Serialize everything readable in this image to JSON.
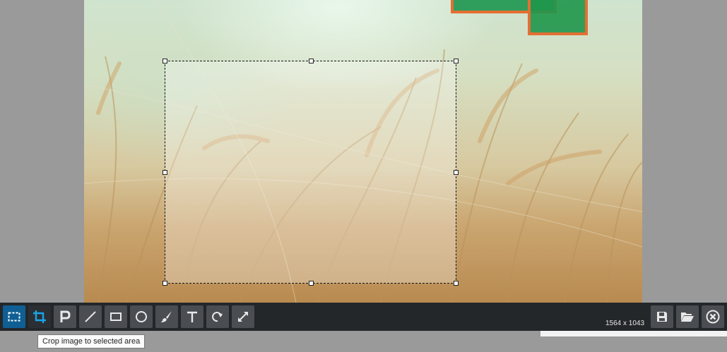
{
  "image": {
    "dimensions_text": "1564 x 1043"
  },
  "toolbar": {
    "tools": [
      {
        "name": "select-tool",
        "icon": "marquee-select-icon",
        "active": true
      },
      {
        "name": "crop-tool",
        "icon": "crop-icon",
        "active": false
      },
      {
        "name": "pixelate-tool",
        "icon": "pixelate-icon",
        "active": false
      },
      {
        "name": "line-tool",
        "icon": "line-icon",
        "active": false
      },
      {
        "name": "rectangle-tool",
        "icon": "rectangle-icon",
        "active": false
      },
      {
        "name": "ellipse-tool",
        "icon": "circle-icon",
        "active": false
      },
      {
        "name": "brush-tool",
        "icon": "brush-icon",
        "active": false
      },
      {
        "name": "text-tool",
        "icon": "text-icon",
        "active": false
      },
      {
        "name": "redo-tool",
        "icon": "redo-icon",
        "active": false
      },
      {
        "name": "resize-tool",
        "icon": "resize-arrows-icon",
        "active": false
      }
    ],
    "actions": [
      {
        "name": "save-button",
        "icon": "floppy-disk-icon"
      },
      {
        "name": "open-button",
        "icon": "folder-open-icon"
      },
      {
        "name": "close-button",
        "icon": "close-circle-icon"
      }
    ]
  },
  "tooltip": {
    "text": "Crop image to selected area"
  },
  "colors": {
    "toolbar_bg": "#24272a",
    "tool_bg": "#4a4e53",
    "tool_active_bg": "#0f5f94",
    "accent_blue": "#1aa3e8",
    "shape_fill": "#2f9e5c",
    "shape_border": "#e36f33"
  }
}
